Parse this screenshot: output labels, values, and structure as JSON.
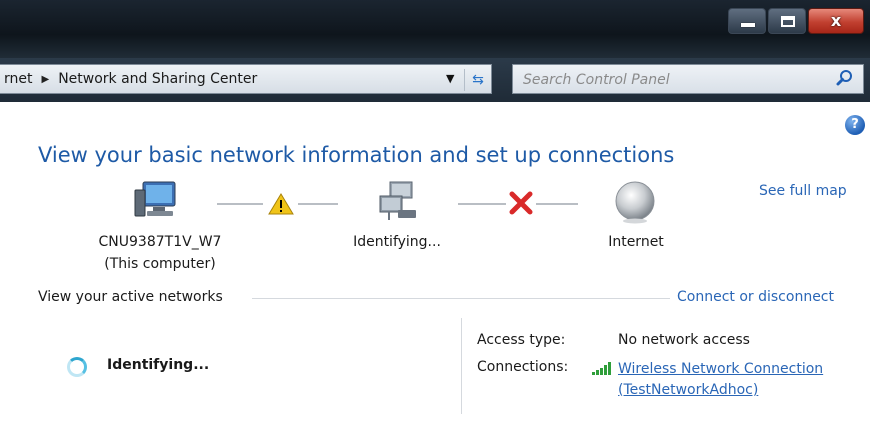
{
  "window": {
    "minimize": "minimize",
    "maximize": "maximize",
    "close": "x"
  },
  "address_bar": {
    "crumb_partial": "rnet",
    "crumb_current": "Network and Sharing Center"
  },
  "search": {
    "placeholder": "Search Control Panel"
  },
  "main": {
    "title": "View your basic network information and set up connections",
    "see_full_map": "See full map",
    "map": {
      "computer_name": "CNU9387T1V_W7",
      "computer_sub": "(This computer)",
      "network_label": "Identifying...",
      "internet_label": "Internet",
      "link1_status": "warning",
      "link2_status": "no connection"
    },
    "active_networks_label": "View your active networks",
    "connect_link": "Connect or disconnect",
    "network": {
      "name": "Identifying...",
      "access_type_key": "Access type:",
      "access_type_value": "No network access",
      "connections_key": "Connections:",
      "connection_name": "Wireless Network Connection",
      "connection_ssid": "(TestNetworkAdhoc)"
    }
  },
  "colors": {
    "link": "#2a66b6",
    "title": "#1e5aa6",
    "warning": "#f0c419",
    "error": "#d92a2a"
  }
}
